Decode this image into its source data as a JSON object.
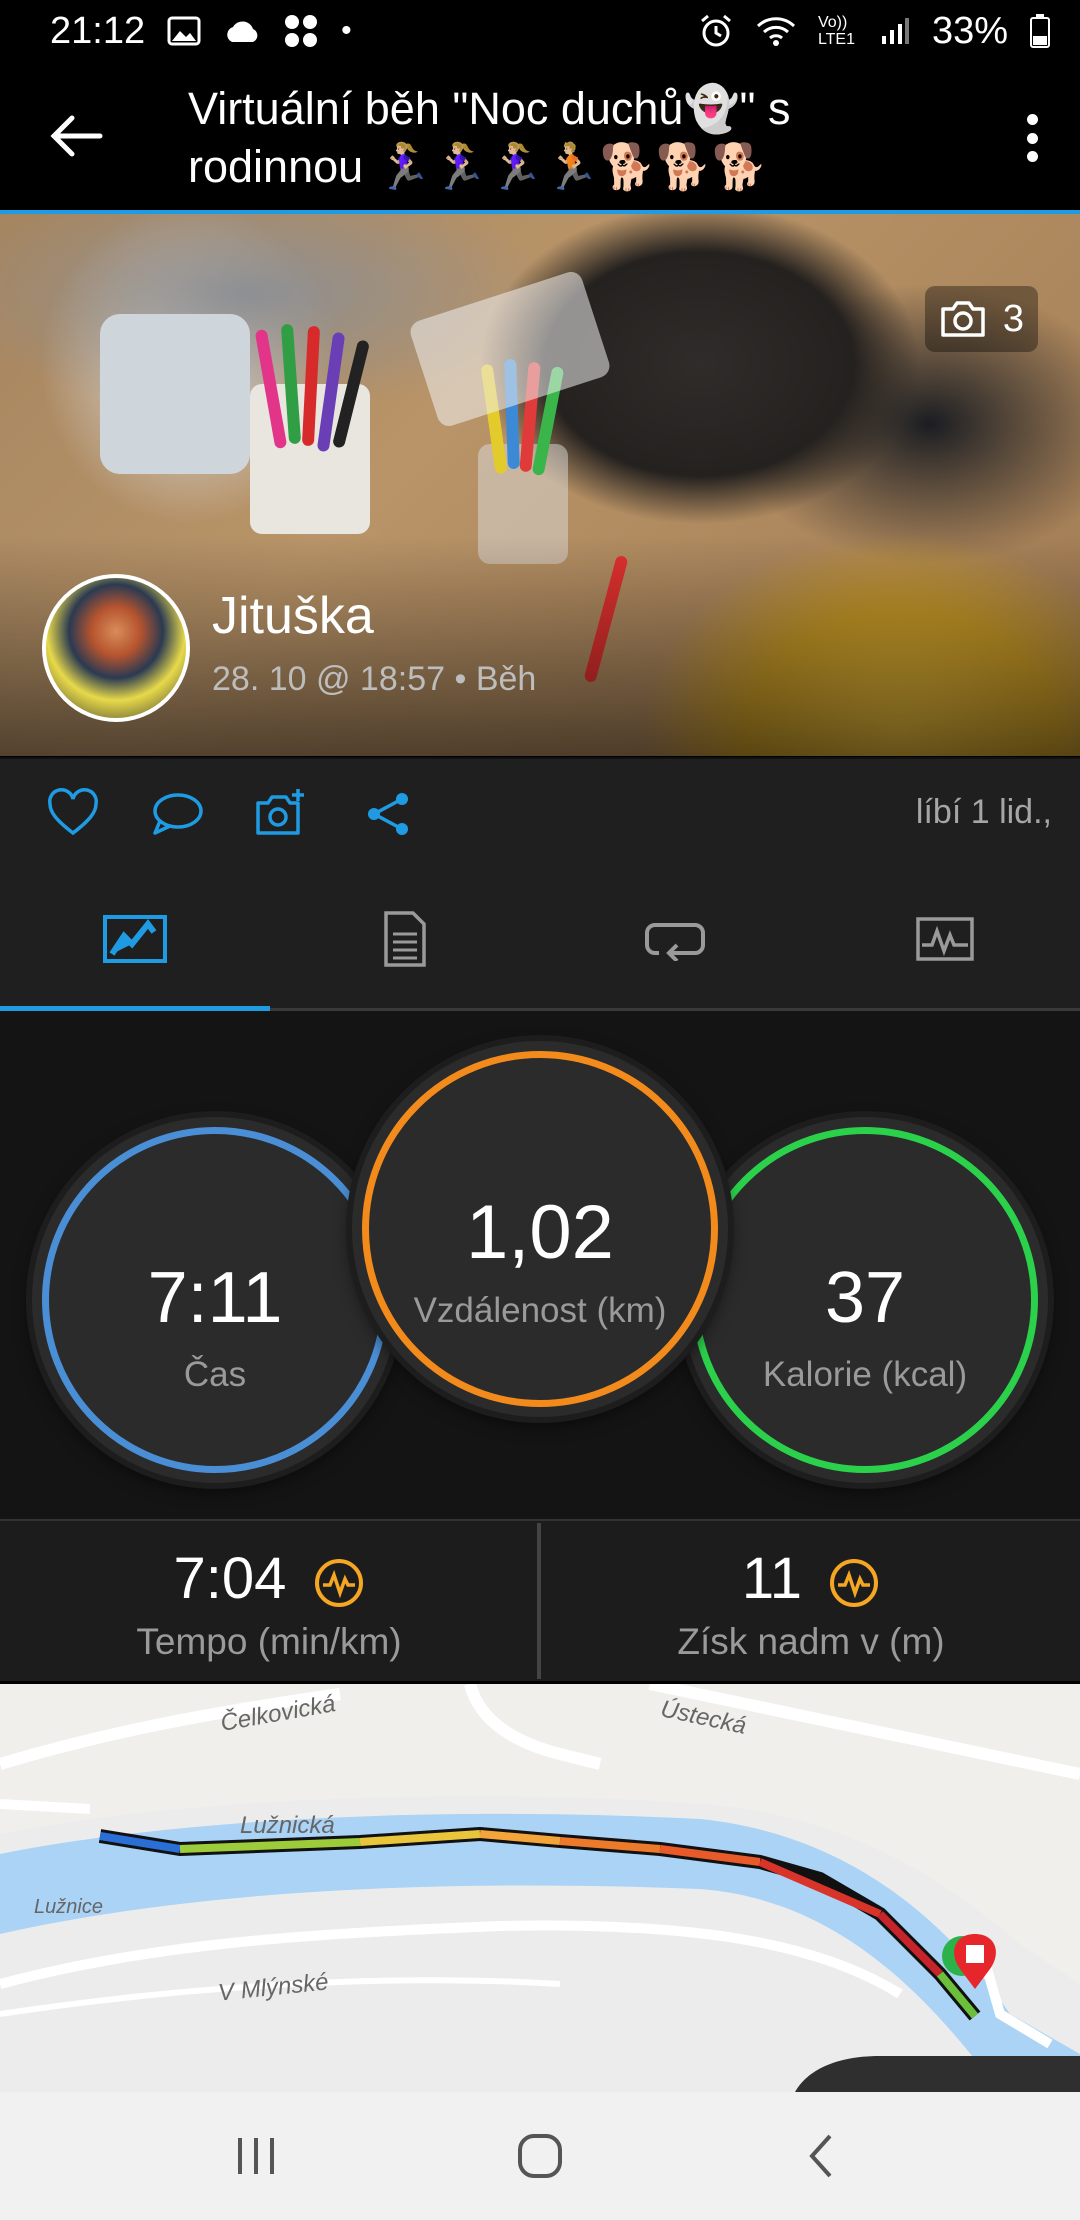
{
  "status_bar": {
    "time": "21:12",
    "dot": "•",
    "network": "Vo)) LTE1",
    "battery": "33%",
    "icons": [
      "image-icon",
      "cloud-icon",
      "apps-icon",
      "alarm-icon",
      "wifi-icon",
      "signal-icon",
      "battery-icon"
    ]
  },
  "header": {
    "title_line1": "Virtuální běh \"Noc duchů👻\" s",
    "title_line2": "rodinnou 🏃🏼‍♀️🏃🏼‍♀️🏃🏼‍♀️🏃🏼🐕🐕🐕"
  },
  "photo": {
    "count": "3",
    "user_name": "Jituška",
    "subline": "28. 10 @ 18:57 • Běh"
  },
  "actions": {
    "likes_text": "líbí 1 lid.,"
  },
  "tabs": [
    "overview-tab",
    "details-tab",
    "laps-tab",
    "charts-tab"
  ],
  "stats": {
    "time_value": "7:11",
    "time_label": "Čas",
    "distance_value": "1,02",
    "distance_label": "Vzdálenost (km)",
    "calories_value": "37",
    "calories_label": "Kalorie (kcal)"
  },
  "metrics": {
    "pace_value": "7:04",
    "pace_label": "Tempo (min/km)",
    "elev_value": "11",
    "elev_label": "Získ nadm v (m)"
  },
  "map": {
    "streets": [
      "Čelkovická",
      "Ústecká",
      "Lužnická",
      "Lužnice",
      "V Mlýnské"
    ]
  },
  "colors": {
    "accent_blue": "#1e9be2",
    "time_ring": "#4a8fd6",
    "distance_ring": "#f28b1c",
    "calories_ring": "#2bd14a",
    "metric_icon": "#f5a623"
  }
}
